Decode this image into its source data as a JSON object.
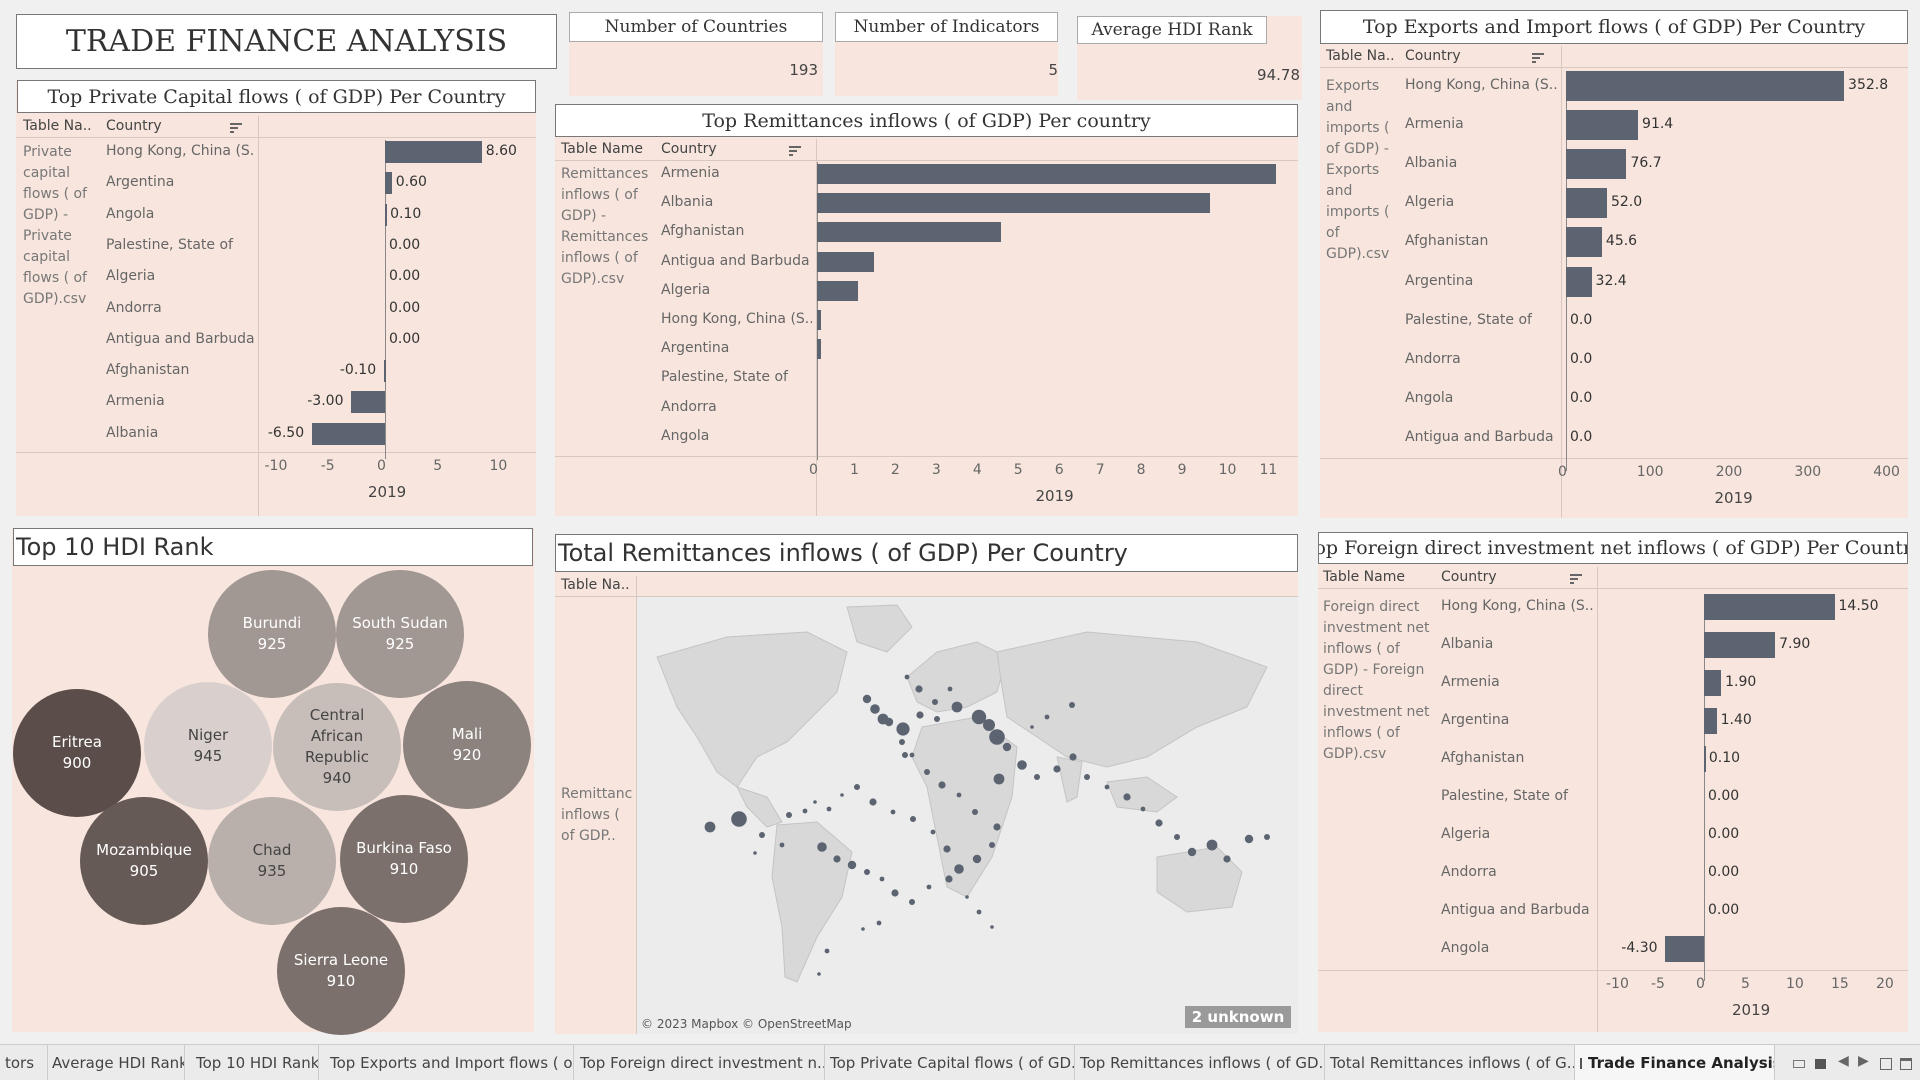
{
  "dashboard": {
    "title": "TRADE FINANCE ANALYSIS",
    "kpis": [
      {
        "label": "Number of Countries",
        "value": "193"
      },
      {
        "label": "Number of Indicators",
        "value": "5"
      },
      {
        "label": "Average HDI Rank",
        "value": "94.78"
      }
    ]
  },
  "headers": {
    "table_name": "Table Name",
    "table_name_short": "Table Na..",
    "country": "Country",
    "year": "2019"
  },
  "private_capital": {
    "title": "Top Private Capital flows ( of GDP) Per Country",
    "table_name_value": "Private capital flows ( of GDP) - Private capital flows ( of GDP).csv",
    "rows": [
      {
        "country": "Hong Kong, China (S..",
        "value": 8.6,
        "label": "8.60"
      },
      {
        "country": "Argentina",
        "value": 0.6,
        "label": "0.60"
      },
      {
        "country": "Angola",
        "value": 0.1,
        "label": "0.10"
      },
      {
        "country": "Palestine, State of",
        "value": 0.0,
        "label": "0.00"
      },
      {
        "country": "Algeria",
        "value": 0.0,
        "label": "0.00"
      },
      {
        "country": "Andorra",
        "value": 0.0,
        "label": "0.00"
      },
      {
        "country": "Antigua and Barbuda",
        "value": 0.0,
        "label": "0.00"
      },
      {
        "country": "Afghanistan",
        "value": -0.1,
        "label": "-0.10"
      },
      {
        "country": "Armenia",
        "value": -3.0,
        "label": "-3.00"
      },
      {
        "country": "Albania",
        "value": -6.5,
        "label": "-6.50"
      }
    ],
    "ticks": [
      "-10",
      "-5",
      "0",
      "5",
      "10"
    ]
  },
  "remittances": {
    "title": "Top Remittances inflows ( of GDP) Per country",
    "table_name_value": "Remittances inflows ( of GDP) - Remittances inflows ( of GDP).csv",
    "rows": [
      {
        "country": "Armenia",
        "value": 11.2
      },
      {
        "country": "Albania",
        "value": 9.6
      },
      {
        "country": "Afghanistan",
        "value": 4.5
      },
      {
        "country": "Antigua and Barbuda",
        "value": 1.4
      },
      {
        "country": "Algeria",
        "value": 1.0
      },
      {
        "country": "Hong Kong, China (S..",
        "value": 0.1
      },
      {
        "country": "Argentina",
        "value": 0.1
      },
      {
        "country": "Palestine, State of",
        "value": 0.0
      },
      {
        "country": "Andorra",
        "value": 0.0
      },
      {
        "country": "Angola",
        "value": 0.0
      }
    ],
    "ticks": [
      "0",
      "1",
      "2",
      "3",
      "4",
      "5",
      "6",
      "7",
      "8",
      "9",
      "10",
      "11"
    ]
  },
  "exports_imports": {
    "title": "Top Exports and Import flows ( of GDP) Per Country",
    "table_name_value": "Exports and imports ( of GDP) - Exports and imports ( of GDP).csv",
    "rows": [
      {
        "country": "Hong Kong, China (S..",
        "value": 352.8,
        "label": "352.8"
      },
      {
        "country": "Armenia",
        "value": 91.4,
        "label": "91.4"
      },
      {
        "country": "Albania",
        "value": 76.7,
        "label": "76.7"
      },
      {
        "country": "Algeria",
        "value": 52.0,
        "label": "52.0"
      },
      {
        "country": "Afghanistan",
        "value": 45.6,
        "label": "45.6"
      },
      {
        "country": "Argentina",
        "value": 32.4,
        "label": "32.4"
      },
      {
        "country": "Palestine, State of",
        "value": 0.0,
        "label": "0.0"
      },
      {
        "country": "Andorra",
        "value": 0.0,
        "label": "0.0"
      },
      {
        "country": "Angola",
        "value": 0.0,
        "label": "0.0"
      },
      {
        "country": "Antigua and Barbuda",
        "value": 0.0,
        "label": "0.0"
      }
    ],
    "ticks": [
      "0",
      "100",
      "200",
      "300",
      "400"
    ]
  },
  "fdi": {
    "title": "Top Foreign direct investment net inflows ( of GDP) Per Country",
    "table_name_value": "Foreign direct investment net inflows ( of GDP) - Foreign direct investment net inflows ( of GDP).csv",
    "rows": [
      {
        "country": "Hong Kong, China (S..",
        "value": 14.5,
        "label": "14.50"
      },
      {
        "country": "Albania",
        "value": 7.9,
        "label": "7.90"
      },
      {
        "country": "Armenia",
        "value": 1.9,
        "label": "1.90"
      },
      {
        "country": "Argentina",
        "value": 1.4,
        "label": "1.40"
      },
      {
        "country": "Afghanistan",
        "value": 0.1,
        "label": "0.10"
      },
      {
        "country": "Palestine, State of",
        "value": 0.0,
        "label": "0.00"
      },
      {
        "country": "Algeria",
        "value": 0.0,
        "label": "0.00"
      },
      {
        "country": "Andorra",
        "value": 0.0,
        "label": "0.00"
      },
      {
        "country": "Antigua and Barbuda",
        "value": 0.0,
        "label": "0.00"
      },
      {
        "country": "Angola",
        "value": -4.3,
        "label": "-4.30"
      }
    ],
    "ticks": [
      "-10",
      "-5",
      "0",
      "5",
      "10",
      "15",
      "20"
    ]
  },
  "hdi": {
    "title": "Top 10 HDI Rank",
    "bubbles": [
      {
        "name": "Burundi",
        "value": "925",
        "color": "#a19793"
      },
      {
        "name": "South Sudan",
        "value": "925",
        "color": "#a19793"
      },
      {
        "name": "Eritrea",
        "value": "900",
        "color": "#5b4e4a"
      },
      {
        "name": "Niger",
        "value": "945",
        "color": "#d9d0cd"
      },
      {
        "name": "Central African Republic",
        "value": "940",
        "color": "#c7bdb9"
      },
      {
        "name": "Mali",
        "value": "920",
        "color": "#8c827e"
      },
      {
        "name": "Mozambique",
        "value": "905",
        "color": "#665a56"
      },
      {
        "name": "Chad",
        "value": "935",
        "color": "#b9afab"
      },
      {
        "name": "Burkina Faso",
        "value": "910",
        "color": "#7b706c"
      },
      {
        "name": "Sierra Leone",
        "value": "910",
        "color": "#7b706c"
      }
    ]
  },
  "map": {
    "title": "Total Remittances inflows ( of GDP) Per Country",
    "row_label": "Remittances inflows ( of GDP..",
    "attribution": "© 2023 Mapbox © OpenStreetMap",
    "unknown_badge": "2 unknown"
  },
  "tabs": [
    {
      "label": "tors"
    },
    {
      "label": "Average HDI Rank"
    },
    {
      "label": "Top 10 HDI Rank"
    },
    {
      "label": "Top Exports and Import flows ( o..."
    },
    {
      "label": "Top Foreign direct investment n..."
    },
    {
      "label": "Top Private Capital flows ( of GD..."
    },
    {
      "label": "Top Remittances inflows ( of GD..."
    },
    {
      "label": "Total Remittances inflows ( of G..."
    },
    {
      "label": "Trade Finance Analysis"
    }
  ],
  "chart_data": [
    {
      "type": "bar",
      "title": "Top Private Capital flows ( of GDP) Per Country",
      "xlabel": "2019",
      "xlim": [
        -10,
        10
      ],
      "categories": [
        "Hong Kong, China (S..",
        "Argentina",
        "Angola",
        "Palestine, State of",
        "Algeria",
        "Andorra",
        "Antigua and Barbuda",
        "Afghanistan",
        "Armenia",
        "Albania"
      ],
      "values": [
        8.6,
        0.6,
        0.1,
        0.0,
        0.0,
        0.0,
        0.0,
        -0.1,
        -3.0,
        -6.5
      ]
    },
    {
      "type": "bar",
      "title": "Top Remittances inflows ( of GDP) Per country",
      "xlabel": "2019",
      "xlim": [
        0,
        11.5
      ],
      "categories": [
        "Armenia",
        "Albania",
        "Afghanistan",
        "Antigua and Barbuda",
        "Algeria",
        "Hong Kong, China (S..",
        "Argentina",
        "Palestine, State of",
        "Andorra",
        "Angola"
      ],
      "values": [
        11.2,
        9.6,
        4.5,
        1.4,
        1.0,
        0.1,
        0.1,
        0.0,
        0.0,
        0.0
      ]
    },
    {
      "type": "bar",
      "title": "Top Exports and Import flows ( of GDP) Per Country",
      "xlabel": "2019",
      "xlim": [
        0,
        420
      ],
      "categories": [
        "Hong Kong, China (S..",
        "Armenia",
        "Albania",
        "Algeria",
        "Afghanistan",
        "Argentina",
        "Palestine, State of",
        "Andorra",
        "Angola",
        "Antigua and Barbuda"
      ],
      "values": [
        352.8,
        91.4,
        76.7,
        52.0,
        45.6,
        32.4,
        0.0,
        0.0,
        0.0,
        0.0
      ]
    },
    {
      "type": "bar",
      "title": "Top Foreign direct investment net inflows ( of GDP) Per Country",
      "xlabel": "2019",
      "xlim": [
        -10,
        20
      ],
      "categories": [
        "Hong Kong, China (S..",
        "Albania",
        "Armenia",
        "Argentina",
        "Afghanistan",
        "Palestine, State of",
        "Algeria",
        "Andorra",
        "Antigua and Barbuda",
        "Angola"
      ],
      "values": [
        14.5,
        7.9,
        1.9,
        1.4,
        0.1,
        0.0,
        0.0,
        0.0,
        0.0,
        -4.3
      ]
    }
  ]
}
